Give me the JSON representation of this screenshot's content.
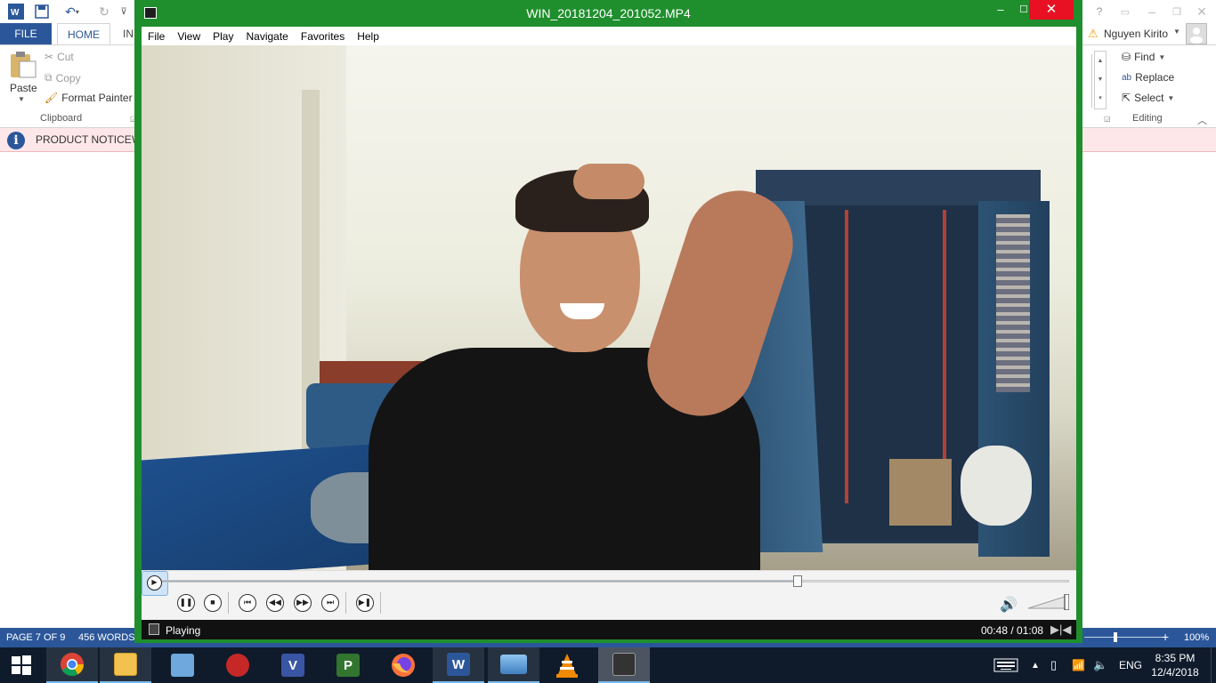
{
  "word": {
    "tabs": {
      "file": "FILE",
      "home": "HOME",
      "insert_partial": "IN"
    },
    "ribbon": {
      "paste": "Paste",
      "cut": "Cut",
      "copy": "Copy",
      "format_painter": "Format Painter",
      "clipboard_group": "Clipboard",
      "find": "Find",
      "replace": "Replace",
      "select": "Select",
      "editing_group": "Editing"
    },
    "user_name": "Nguyen Kirito",
    "help": "?",
    "notice": {
      "label": "PRODUCT NOTICE",
      "partial": "W"
    },
    "status": {
      "page": "PAGE 7 OF 9",
      "words": "456 WORDS",
      "zoom": "100%"
    }
  },
  "player": {
    "window_title": "WIN_20181204_201052.MP4",
    "menu": [
      "File",
      "View",
      "Play",
      "Navigate",
      "Favorites",
      "Help"
    ],
    "status_text": "Playing",
    "time_display": "00:48 / 01:08",
    "elapsed_seconds": 48,
    "duration_seconds": 68,
    "volume_level": 1.0,
    "controls": [
      "play",
      "pause",
      "stop",
      "previous",
      "rewind",
      "fast-forward",
      "next",
      "frame-step"
    ]
  },
  "taskbar": {
    "apps": [
      "chrome",
      "file-explorer",
      "control-panel",
      "garena",
      "visio",
      "project",
      "firefox",
      "word",
      "photos",
      "vlc",
      "media-player-classic"
    ],
    "language": "ENG",
    "time": "8:35 PM",
    "date": "12/4/2018"
  },
  "colors": {
    "player_frame": "#1f8f2d",
    "close_button": "#e81123",
    "word_accent": "#2b579a",
    "taskbar": "#0f1b2b",
    "notice_bg": "#fde7e9"
  }
}
